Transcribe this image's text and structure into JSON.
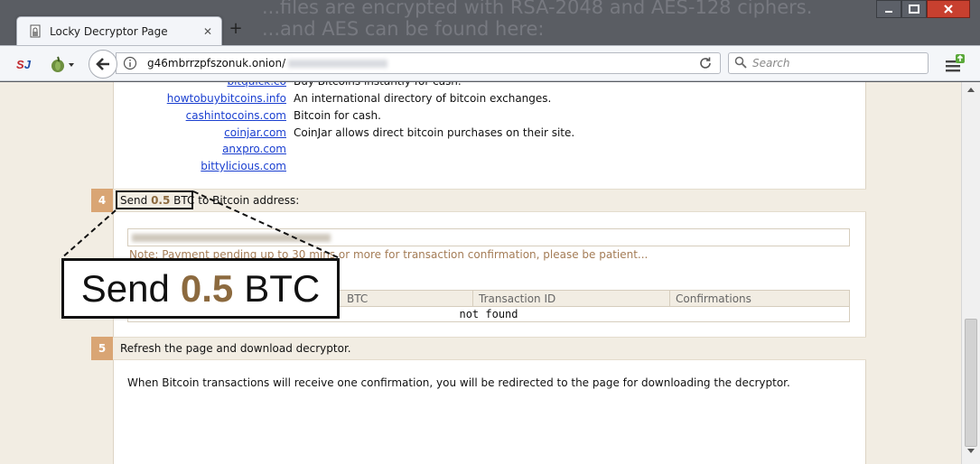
{
  "background": {
    "line1": "...files are encrypted with RSA-2048 and AES-128 ciphers.",
    "line2": "...and AES can be found here:"
  },
  "browser": {
    "tab_title": "Locky Decryptor Page",
    "new_tab": "+",
    "url": "g46mbrrzpfszonuk.onion/",
    "search_placeholder": "Search",
    "icons": [
      "lock-doc-icon",
      "close-icon",
      "plus-icon",
      "minimize-icon",
      "maximize-icon",
      "close-window-icon",
      "sj-addon-icon",
      "onion-icon",
      "back-arrow-icon",
      "info-icon",
      "reload-icon",
      "search-icon",
      "menu-icon"
    ]
  },
  "exchanges": [
    {
      "name": "bitquick.co",
      "desc": "Buy Bitcoins instantly for cash."
    },
    {
      "name": "howtobuybitcoins.info",
      "desc": "An international directory of bitcoin exchanges."
    },
    {
      "name": "cashintocoins.com",
      "desc": "Bitcoin for cash."
    },
    {
      "name": "coinjar.com",
      "desc": "CoinJar allows direct bitcoin purchases on their site."
    },
    {
      "name": "anxpro.com",
      "desc": ""
    },
    {
      "name": "bittylicious.com",
      "desc": ""
    }
  ],
  "step4": {
    "number": "4",
    "prefix": "Send",
    "amount": "0.5",
    "currency": "BTC",
    "suffix": "to Bitcoin address:",
    "note": "Note: Payment pending up to 30 mins or more for transaction confirmation, please be patient...",
    "table": {
      "columns": [
        "BTC",
        "Transaction ID",
        "Confirmations"
      ],
      "empty_text": "not found"
    }
  },
  "step5": {
    "number": "5",
    "title": "Refresh the page and download decryptor.",
    "body": "When Bitcoin transactions will receive one confirmation, you will be redirected to the page for downloading the decryptor."
  },
  "callout": {
    "prefix": "Send",
    "amount": "0.5",
    "currency": "BTC"
  },
  "colors": {
    "accent": "#d9a574",
    "amount": "#8c6a3f",
    "link": "#1a3fd0",
    "close_button": "#c8402f"
  }
}
